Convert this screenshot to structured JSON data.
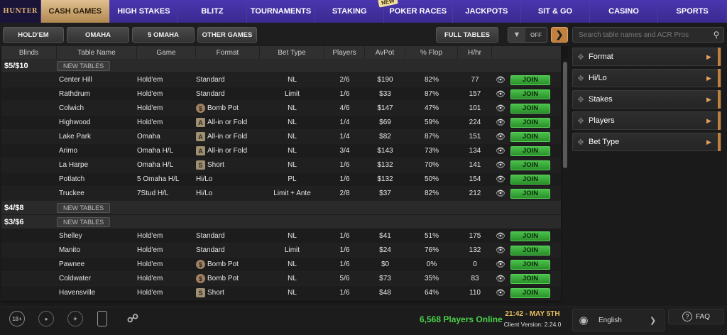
{
  "logo": "HUNTER",
  "nav": {
    "tabs": [
      {
        "label": "CASH GAMES",
        "active": true
      },
      {
        "label": "HIGH STAKES"
      },
      {
        "label": "BLITZ"
      },
      {
        "label": "TOURNAMENTS"
      },
      {
        "label": "STAKING"
      },
      {
        "label": "POKER RACES",
        "badge": "NEW"
      },
      {
        "label": "JACKPOTS"
      },
      {
        "label": "SIT & GO"
      },
      {
        "label": "CASINO"
      },
      {
        "label": "SPORTS"
      }
    ]
  },
  "filters": {
    "game_buttons": [
      "HOLD'EM",
      "OMAHA",
      "5 OMAHA",
      "OTHER GAMES"
    ],
    "full_tables": "FULL TABLES",
    "toggle_label": "OFF",
    "search_placeholder": "Search table names and ACR Pros"
  },
  "table": {
    "headers": [
      "Blinds",
      "Table Name",
      "Game",
      "Format",
      "Bet Type",
      "Players",
      "AvPot",
      "% Flop",
      "H/hr"
    ],
    "new_tables_label": "NEW TABLES",
    "join_label": "JOIN",
    "groups": [
      {
        "stake": "$5/$10",
        "rows": [
          {
            "name": "Center Hill",
            "game": "Hold'em",
            "format": "Standard",
            "icon": "",
            "bet": "NL",
            "players": "2/6",
            "avpot": "$190",
            "flop": "82%",
            "hhr": "77"
          },
          {
            "name": "Rathdrum",
            "game": "Hold'em",
            "format": "Standard",
            "icon": "",
            "bet": "Limit",
            "players": "1/6",
            "avpot": "$33",
            "flop": "87%",
            "hhr": "157"
          },
          {
            "name": "Colwich",
            "game": "Hold'em",
            "format": "Bomb Pot",
            "icon": "bomb",
            "bet": "NL",
            "players": "4/6",
            "avpot": "$147",
            "flop": "47%",
            "hhr": "101"
          },
          {
            "name": "Highwood",
            "game": "Hold'em",
            "format": "All-in or Fold",
            "icon": "A",
            "bet": "NL",
            "players": "1/4",
            "avpot": "$69",
            "flop": "59%",
            "hhr": "224"
          },
          {
            "name": "Lake Park",
            "game": "Omaha",
            "format": "All-in or Fold",
            "icon": "A",
            "bet": "NL",
            "players": "1/4",
            "avpot": "$82",
            "flop": "87%",
            "hhr": "151"
          },
          {
            "name": "Arimo",
            "game": "Omaha H/L",
            "format": "All-in or Fold",
            "icon": "A",
            "bet": "NL",
            "players": "3/4",
            "avpot": "$143",
            "flop": "73%",
            "hhr": "134"
          },
          {
            "name": "La Harpe",
            "game": "Omaha H/L",
            "format": "Short",
            "icon": "S",
            "bet": "NL",
            "players": "1/6",
            "avpot": "$132",
            "flop": "70%",
            "hhr": "141"
          },
          {
            "name": "Potlatch",
            "game": "5 Omaha H/L",
            "format": "Hi/Lo",
            "icon": "",
            "bet": "PL",
            "players": "1/6",
            "avpot": "$132",
            "flop": "50%",
            "hhr": "154"
          },
          {
            "name": "Truckee",
            "game": "7Stud H/L",
            "format": "Hi/Lo",
            "icon": "",
            "bet": "Limit + Ante",
            "players": "2/8",
            "avpot": "$37",
            "flop": "82%",
            "hhr": "212"
          }
        ]
      },
      {
        "stake": "$4/$8",
        "rows": []
      },
      {
        "stake": "$3/$6",
        "rows": [
          {
            "name": "Shelley",
            "game": "Hold'em",
            "format": "Standard",
            "icon": "",
            "bet": "NL",
            "players": "1/6",
            "avpot": "$41",
            "flop": "51%",
            "hhr": "175"
          },
          {
            "name": "Manito",
            "game": "Hold'em",
            "format": "Standard",
            "icon": "",
            "bet": "Limit",
            "players": "1/6",
            "avpot": "$24",
            "flop": "76%",
            "hhr": "132"
          },
          {
            "name": "Pawnee",
            "game": "Hold'em",
            "format": "Bomb Pot",
            "icon": "bomb",
            "bet": "NL",
            "players": "1/6",
            "avpot": "$0",
            "flop": "0%",
            "hhr": "0"
          },
          {
            "name": "Coldwater",
            "game": "Hold'em",
            "format": "Bomb Pot",
            "icon": "bomb",
            "bet": "NL",
            "players": "5/6",
            "avpot": "$73",
            "flop": "35%",
            "hhr": "83"
          },
          {
            "name": "Havensville",
            "game": "Hold'em",
            "format": "Short",
            "icon": "S",
            "bet": "NL",
            "players": "1/6",
            "avpot": "$48",
            "flop": "64%",
            "hhr": "110"
          }
        ]
      }
    ]
  },
  "right_panel": {
    "items": [
      "Format",
      "Hi/Lo",
      "Stakes",
      "Players",
      "Bet Type"
    ]
  },
  "footer": {
    "age_badge": "18+",
    "players_online": "6,568 Players Online",
    "clock": "21:42 - MAY 5TH",
    "client_version": "Client Version: 2.24.0",
    "language": "English",
    "faq": "FAQ"
  },
  "colors": {
    "accent": "#c08040",
    "join": "#3ab03a",
    "online": "#4ad04a",
    "nav": "#3a2a90"
  }
}
